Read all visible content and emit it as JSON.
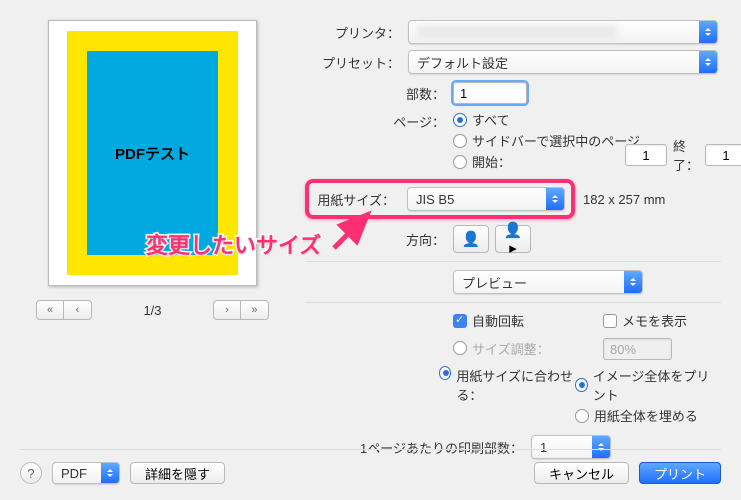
{
  "header": {
    "printer_label": "プリンタ：",
    "preset_label": "プリセット：",
    "preset_value": "デフォルト設定"
  },
  "copies": {
    "label": "部数：",
    "value": "1"
  },
  "pages": {
    "label": "ページ：",
    "all": "すべて",
    "sidebar": "サイドバーで選択中のページ",
    "range": "開始：",
    "from_value": "1",
    "to_label": "終了：",
    "to_value": "1"
  },
  "paper": {
    "label": "用紙サイズ：",
    "value": "JIS B5",
    "dims": "182 x 257 mm"
  },
  "orientation": {
    "label": "方向："
  },
  "section_select": {
    "value": "プレビュー"
  },
  "options": {
    "auto_rotate": "自動回転",
    "show_notes": "メモを表示",
    "size_adjust": "サイズ調整：",
    "size_adjust_value": "80%",
    "fit_to_paper": "用紙サイズに合わせる：",
    "print_image": "イメージ全体をプリント",
    "fill_paper": "用紙全体を埋める"
  },
  "copies_per_page": {
    "label": "1ページあたりの印刷部数：",
    "value": "1"
  },
  "preview": {
    "doc_text": "PDFテスト",
    "page_indicator": "1/3"
  },
  "annotation": {
    "text": "変更したいサイズ"
  },
  "footer": {
    "pdf_label": "PDF",
    "details": "詳細を隠す",
    "cancel": "キャンセル",
    "print": "プリント"
  }
}
